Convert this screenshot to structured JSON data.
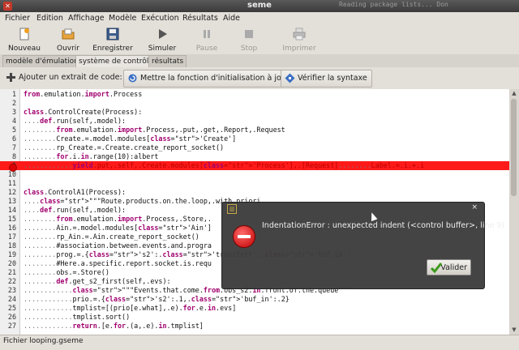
{
  "window": {
    "title": "seme",
    "ghost_text": "Reading package lists... Don",
    "app_icon": "cross-icon"
  },
  "menu": [
    "Fichier",
    "Edition",
    "Affichage",
    "Modèle",
    "Exécution",
    "Résultats",
    "Aide"
  ],
  "toolbar": {
    "new": "Nouveau",
    "open": "Ouvrir",
    "save": "Enregistrer",
    "simulate": "Simuler",
    "pause": "Pause",
    "stop": "Stop",
    "print": "Imprimer"
  },
  "tabs": [
    "modèle d'émulation",
    "système de contrôle",
    "résultats"
  ],
  "actions": {
    "add_code": "Ajouter un extrait de code:",
    "init": "Mettre la fonction d'initialisation à jour",
    "check": "Vérifier la syntaxe"
  },
  "code_lines": [
    {
      "n": "1",
      "t": "from.emulation.import.Process"
    },
    {
      "n": "2",
      "t": ""
    },
    {
      "n": "3",
      "t": "class.ControlCreate(Process):"
    },
    {
      "n": "4",
      "t": "....def.run(self,.model):"
    },
    {
      "n": "5",
      "t": "........from.emulation.import.Process,.put,.get,.Report,.Request"
    },
    {
      "n": "6",
      "t": "........Create.=.model.modules['Create']"
    },
    {
      "n": "7",
      "t": "........rp_Create.=.Create.create_report_socket()"
    },
    {
      "n": "8",
      "t": "........for.i.in.range(10):albert"
    },
    {
      "n": "9",
      "t": "............yield.put,.self,.Create.modules['Process'],.[Request]........Label.=.i.+.i"
    },
    {
      "n": "10",
      "t": ""
    },
    {
      "n": "11",
      "t": ""
    },
    {
      "n": "12",
      "t": "class.ControlA1(Process):"
    },
    {
      "n": "13",
      "t": "....\"\"\"Route.products.on.the.loop,.with.priori"
    },
    {
      "n": "14",
      "t": "....def.run(self,.model):"
    },
    {
      "n": "15",
      "t": "........from.emulation.import.Process,.Store,."
    },
    {
      "n": "16",
      "t": "........Ain.=.model.modules['Ain']"
    },
    {
      "n": "17",
      "t": "........rp_Ain.=.Ain.create_report_socket()"
    },
    {
      "n": "18",
      "t": "........#association.between.events.and.progra"
    },
    {
      "n": "19",
      "t": "........prog.=.{'s2':.'transfert',.'buf_in':.'"
    },
    {
      "n": "20",
      "t": "........#Here.a.specific.report.socket.is.requ"
    },
    {
      "n": "21",
      "t": "........obs.=.Store()"
    },
    {
      "n": "22",
      "t": "........def.get_s2_first(self,.evs):"
    },
    {
      "n": "23",
      "t": "............\"\"\"Events.that.come.from.obs_s2.in.front.of.the.queue\"\"\""
    },
    {
      "n": "24",
      "t": "............prio.=.{'s2':.1,.'buf_in':.2}"
    },
    {
      "n": "25",
      "t": "............tmplist=[(prio[e.what],.e).for.e.in.evs]"
    },
    {
      "n": "26",
      "t": "............tmplist.sort()"
    },
    {
      "n": "27",
      "t": "............return.[e.for.(a,.e).in.tmplist]"
    }
  ],
  "error_line": "9",
  "status": "Fichier looping.gseme",
  "dialog": {
    "message": "IndentationError : unexpected indent (<control buffer>, line 9)",
    "button": "Valider",
    "close": "×"
  },
  "colors": {
    "error_highlight": "#ff1a1a",
    "keyword": "#a0006e",
    "string": "#cc2277"
  }
}
